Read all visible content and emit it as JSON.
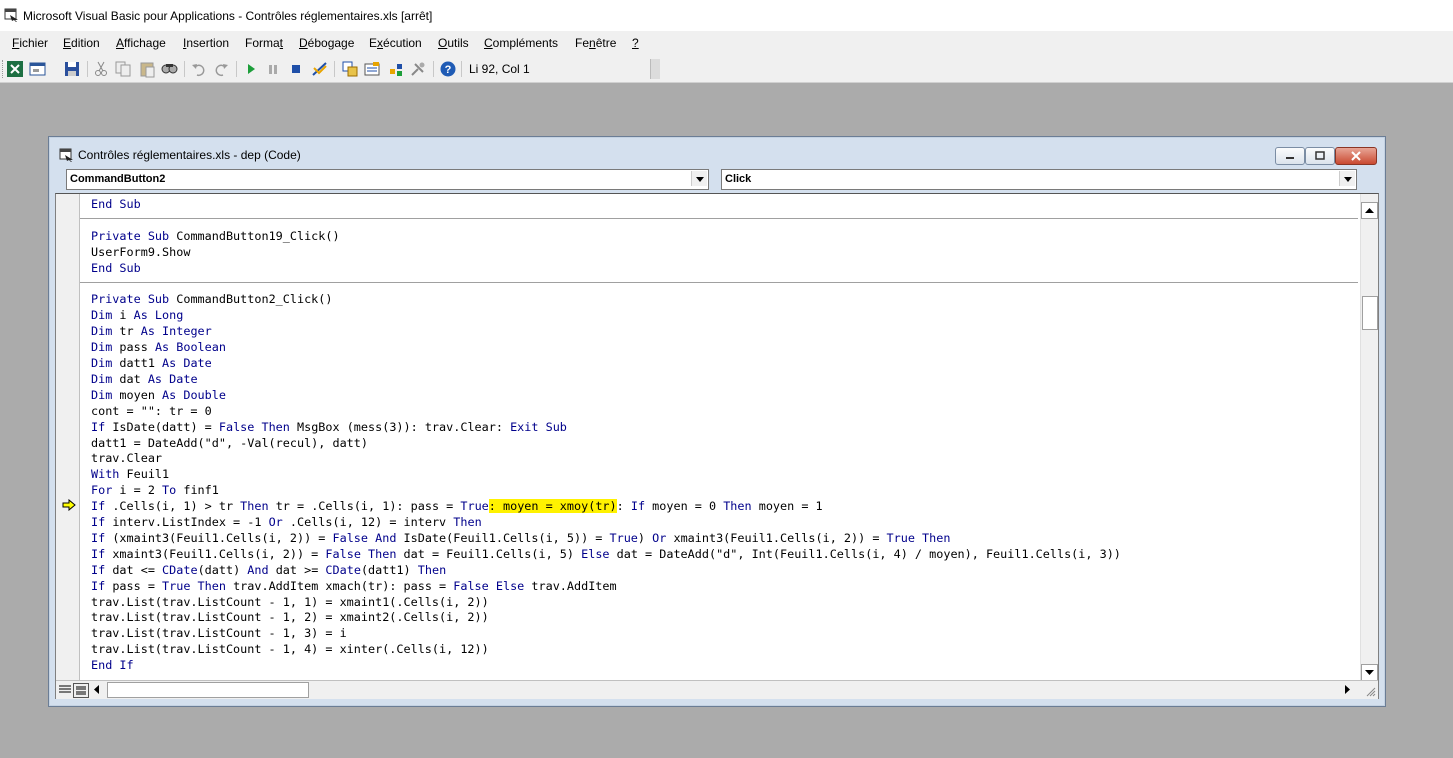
{
  "window": {
    "title": "Microsoft Visual Basic pour Applications - Contrôles réglementaires.xls [arrêt]"
  },
  "menu": [
    {
      "pre": "",
      "ul": "F",
      "post": "ichier"
    },
    {
      "pre": "",
      "ul": "E",
      "post": "dition"
    },
    {
      "pre": "",
      "ul": "A",
      "post": "ffichage"
    },
    {
      "pre": "",
      "ul": "I",
      "post": "nsertion"
    },
    {
      "pre": "Forma",
      "ul": "t",
      "post": ""
    },
    {
      "pre": "",
      "ul": "D",
      "post": "ébogage"
    },
    {
      "pre": "E",
      "ul": "x",
      "post": "écution"
    },
    {
      "pre": "",
      "ul": "O",
      "post": "utils"
    },
    {
      "pre": "",
      "ul": "C",
      "post": "ompléments"
    },
    {
      "pre": "Fe",
      "ul": "n",
      "post": "être"
    },
    {
      "pre": "",
      "ul": "?",
      "post": ""
    }
  ],
  "toolbar": {
    "icons": [
      "excel-icon",
      "insert-userform-icon",
      "save-icon",
      "cut-icon",
      "copy-icon",
      "paste-icon",
      "find-icon",
      "undo-icon",
      "redo-icon",
      "run-icon",
      "break-icon",
      "reset-icon",
      "design-mode-icon",
      "project-explorer-icon",
      "properties-icon",
      "object-browser-icon",
      "toolbox-icon",
      "help-icon"
    ],
    "position": "Li 92, Col 1"
  },
  "code_window": {
    "title": "Contrôles réglementaires.xls - dep (Code)",
    "object_dropdown": "CommandButton2",
    "procedure_dropdown": "Click"
  },
  "code_lines": [
    [
      {
        "t": "End Sub",
        "k": 1
      }
    ],
    [],
    [
      {
        "t": "Private Sub",
        "k": 1
      },
      {
        "t": " CommandButton19_Click()"
      }
    ],
    [
      {
        "t": "UserForm9.Show"
      }
    ],
    [
      {
        "t": "End Sub",
        "k": 1
      }
    ],
    [],
    [
      {
        "t": "Private Sub",
        "k": 1
      },
      {
        "t": " CommandButton2_Click()"
      }
    ],
    [
      {
        "t": "Dim",
        "k": 1
      },
      {
        "t": " i "
      },
      {
        "t": "As Long",
        "k": 1
      }
    ],
    [
      {
        "t": "Dim",
        "k": 1
      },
      {
        "t": " tr "
      },
      {
        "t": "As Integer",
        "k": 1
      }
    ],
    [
      {
        "t": "Dim",
        "k": 1
      },
      {
        "t": " pass "
      },
      {
        "t": "As Boolean",
        "k": 1
      }
    ],
    [
      {
        "t": "Dim",
        "k": 1
      },
      {
        "t": " datt1 "
      },
      {
        "t": "As Date",
        "k": 1
      }
    ],
    [
      {
        "t": "Dim",
        "k": 1
      },
      {
        "t": " dat "
      },
      {
        "t": "As Date",
        "k": 1
      }
    ],
    [
      {
        "t": "Dim",
        "k": 1
      },
      {
        "t": " moyen "
      },
      {
        "t": "As Double",
        "k": 1
      }
    ],
    [
      {
        "t": "cont = \"\": tr = 0"
      }
    ],
    [
      {
        "t": "If",
        "k": 1
      },
      {
        "t": " IsDate(datt) = "
      },
      {
        "t": "False Then",
        "k": 1
      },
      {
        "t": " MsgBox (mess(3)): trav.Clear: "
      },
      {
        "t": "Exit Sub",
        "k": 1
      }
    ],
    [
      {
        "t": "datt1 = DateAdd(\"d\", -Val(recul), datt)"
      }
    ],
    [
      {
        "t": "trav.Clear"
      }
    ],
    [
      {
        "t": "With",
        "k": 1
      },
      {
        "t": " Feuil1"
      }
    ],
    [
      {
        "t": "For",
        "k": 1
      },
      {
        "t": " i = 2 "
      },
      {
        "t": "To",
        "k": 1
      },
      {
        "t": " finf1"
      }
    ],
    [
      {
        "t": "If",
        "k": 1
      },
      {
        "t": " .Cells(i, 1) > tr "
      },
      {
        "t": "Then",
        "k": 1
      },
      {
        "t": " tr = .Cells(i, 1): pass = "
      },
      {
        "t": "True",
        "k": 1
      },
      {
        "t": ": moyen = xmoy(tr)",
        "h": 1
      },
      {
        "t": ": "
      },
      {
        "t": "If",
        "k": 1
      },
      {
        "t": " moyen = 0 "
      },
      {
        "t": "Then",
        "k": 1
      },
      {
        "t": " moyen = 1"
      }
    ],
    [
      {
        "t": "If",
        "k": 1
      },
      {
        "t": " interv.ListIndex = -1 "
      },
      {
        "t": "Or",
        "k": 1
      },
      {
        "t": " .Cells(i, 12) = interv "
      },
      {
        "t": "Then",
        "k": 1
      }
    ],
    [
      {
        "t": "If",
        "k": 1
      },
      {
        "t": " (xmaint3(Feuil1.Cells(i, 2)) = "
      },
      {
        "t": "False And",
        "k": 1
      },
      {
        "t": " IsDate(Feuil1.Cells(i, 5)) = "
      },
      {
        "t": "True",
        "k": 1
      },
      {
        "t": ") "
      },
      {
        "t": "Or",
        "k": 1
      },
      {
        "t": " xmaint3(Feuil1.Cells(i, 2)) = "
      },
      {
        "t": "True Then",
        "k": 1
      }
    ],
    [
      {
        "t": "If",
        "k": 1
      },
      {
        "t": " xmaint3(Feuil1.Cells(i, 2)) = "
      },
      {
        "t": "False Then",
        "k": 1
      },
      {
        "t": " dat = Feuil1.Cells(i, 5) "
      },
      {
        "t": "Else",
        "k": 1
      },
      {
        "t": " dat = DateAdd(\"d\", Int(Feuil1.Cells(i, 4) / moyen), Feuil1.Cells(i, 3))"
      }
    ],
    [
      {
        "t": "If",
        "k": 1
      },
      {
        "t": " dat <= "
      },
      {
        "t": "CDate",
        "k": 1
      },
      {
        "t": "(datt) "
      },
      {
        "t": "And",
        "k": 1
      },
      {
        "t": " dat >= "
      },
      {
        "t": "CDate",
        "k": 1
      },
      {
        "t": "(datt1) "
      },
      {
        "t": "Then",
        "k": 1
      }
    ],
    [
      {
        "t": "If",
        "k": 1
      },
      {
        "t": " pass = "
      },
      {
        "t": "True Then",
        "k": 1
      },
      {
        "t": " trav.AddItem xmach(tr): pass = "
      },
      {
        "t": "False Else",
        "k": 1
      },
      {
        "t": " trav.AddItem"
      }
    ],
    [
      {
        "t": "trav.List(trav.ListCount - 1, 1) = xmaint1(.Cells(i, 2))"
      }
    ],
    [
      {
        "t": "trav.List(trav.ListCount - 1, 2) = xmaint2(.Cells(i, 2))"
      }
    ],
    [
      {
        "t": "trav.List(trav.ListCount - 1, 3) = i"
      }
    ],
    [
      {
        "t": "trav.List(trav.ListCount - 1, 4) = xinter(.Cells(i, 12))"
      }
    ],
    [
      {
        "t": "End If",
        "k": 1
      }
    ]
  ],
  "current_line_index": 19,
  "colors": {
    "keyword": "#00008b",
    "highlight": "#fff200"
  }
}
